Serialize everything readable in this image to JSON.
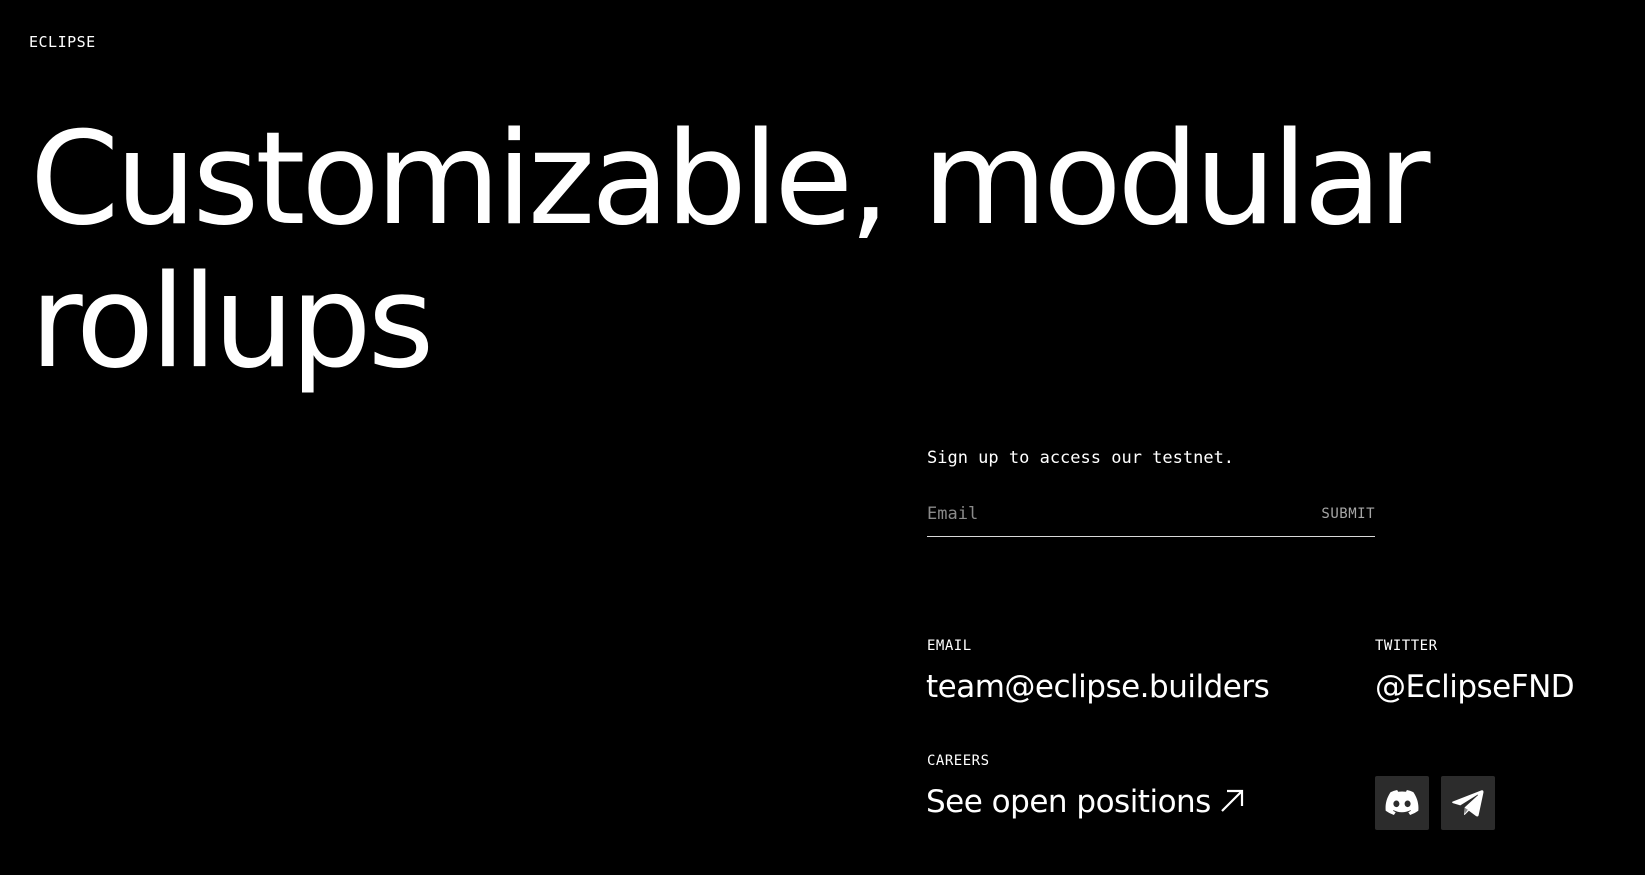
{
  "header": {
    "logo": "ECLIPSE"
  },
  "hero": {
    "line1": "Customizable, modular",
    "line2": "rollups"
  },
  "signup": {
    "prompt": "Sign up to access our testnet.",
    "email_placeholder": "Email",
    "submit_label": "SUBMIT"
  },
  "contact": {
    "email_label": "EMAIL",
    "email_value": "team@eclipse.builders",
    "twitter_label": "TWITTER",
    "twitter_value": "@EclipseFND",
    "careers_label": "CAREERS",
    "careers_value": "See open positions"
  },
  "social": {
    "icons": [
      "discord-icon",
      "telegram-icon"
    ],
    "button_bg": "#2c2c2c"
  },
  "colors": {
    "background": "#000000",
    "text": "#ffffff",
    "muted": "#8a8a8a"
  }
}
